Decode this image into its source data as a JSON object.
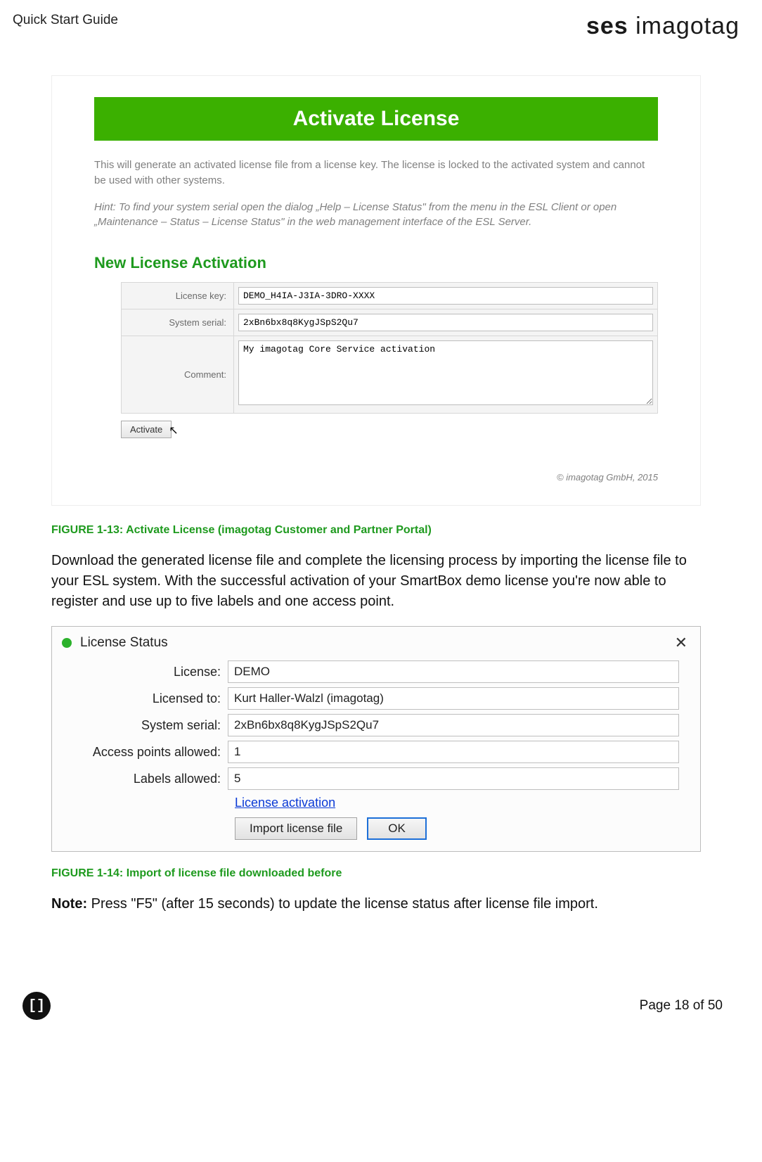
{
  "header": {
    "title": "Quick Start Guide",
    "logo_bold": "ses",
    "logo_light": "imagotag"
  },
  "portal": {
    "banner": "Activate License",
    "desc": "This will generate an activated license file from a license key. The license is locked to the activated system and cannot be used with other systems.",
    "hint": "Hint: To find your system serial open the dialog „Help – License Status\" from the menu in the ESL Client or open „Maintenance – Status – License Status\" in the web management interface of the ESL Server.",
    "subhead": "New License Activation",
    "fields": {
      "license_key_label": "License key:",
      "license_key_value": "DEMO_H4IA-J3IA-3DRO-XXXX",
      "system_serial_label": "System serial:",
      "system_serial_value": "2xBn6bx8q8KygJSpS2Qu7",
      "comment_label": "Comment:",
      "comment_value": "My imagotag Core Service activation"
    },
    "activate_button": "Activate",
    "copyright": "© imagotag GmbH, 2015"
  },
  "figure1_caption": "FIGURE 1-13: Activate License (imagotag Customer and Partner Portal)",
  "para1": "Download the generated license file and complete the licensing process by importing the license file to your ESL system. With the successful activation of your SmartBox demo license you're now able to register and use up to five labels and one access point.",
  "dialog": {
    "title": "License Status",
    "close": "✕",
    "rows": {
      "license_label": "License:",
      "license_value": "DEMO",
      "licensed_to_label": "Licensed to:",
      "licensed_to_value": "Kurt Haller-Walzl (imagotag)",
      "system_serial_label": "System serial:",
      "system_serial_value": "2xBn6bx8q8KygJSpS2Qu7",
      "ap_allowed_label": "Access points allowed:",
      "ap_allowed_value": "1",
      "labels_allowed_label": "Labels allowed:",
      "labels_allowed_value": "5"
    },
    "link": "License activation",
    "import_button": "Import license file",
    "ok_button": "OK"
  },
  "figure2_caption": "FIGURE 1-14: Import of license file downloaded before",
  "note_label": "Note:",
  "note_text": " Press \"F5\" (after 15 seconds) to update the license status after license file import.",
  "footer": {
    "icon": "[]",
    "page": "Page 18 of 50"
  }
}
